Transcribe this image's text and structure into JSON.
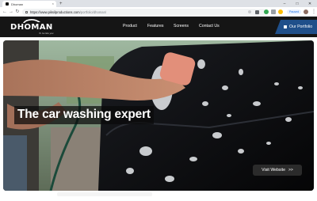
{
  "browser": {
    "tab_title": "Dhoman",
    "new_tab_symbol": "+",
    "tab_close_symbol": "×",
    "url_main": "https://www.piksilproductions.com",
    "url_path": "/portfolio/dhoman/",
    "paused_label": "Paused",
    "controls": {
      "back": "←",
      "forward": "→",
      "reload": "↻",
      "menu": "⋮",
      "minimize": "–",
      "maximize": "□",
      "close": "✕"
    }
  },
  "site": {
    "logo": {
      "name": "DHOMAN",
      "tagline": "To be like you"
    },
    "nav": [
      "Product",
      "Features",
      "Screens",
      "Contact Us"
    ],
    "portfolio_button": "Our Portfolio"
  },
  "hero": {
    "title": "The car washing expert",
    "button_label": "Visit Website",
    "button_arrow": ">>"
  },
  "colors": {
    "header_bg": "#151515",
    "portfolio_bg": "#1f4f8a",
    "button_bg": "#2b2b2b",
    "car_body": "#0c0c0e"
  },
  "icons": [
    "back-icon",
    "forward-icon",
    "reload-icon",
    "lock-icon",
    "star-icon",
    "profile-icon",
    "menu-icon",
    "portfolio-icon",
    "car-logo-icon"
  ]
}
